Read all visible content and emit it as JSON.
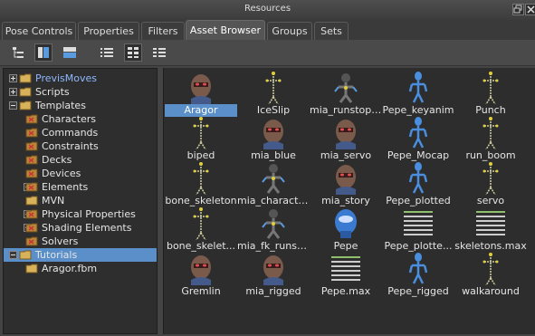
{
  "window": {
    "title": "Resources"
  },
  "tabs": [
    {
      "label": "Pose Controls"
    },
    {
      "label": "Properties"
    },
    {
      "label": "Filters"
    },
    {
      "label": "Asset Browser",
      "active": true
    },
    {
      "label": "Groups"
    },
    {
      "label": "Sets"
    }
  ],
  "toolbar": {
    "buttons": [
      {
        "icon": "tree-hierarchy-icon"
      },
      {
        "icon": "split-vertical-icon",
        "active": true
      },
      {
        "icon": "split-horizontal-icon"
      },
      {
        "icon": "list-view-icon"
      },
      {
        "icon": "thumbnail-view-icon",
        "active": true
      },
      {
        "icon": "details-view-icon"
      }
    ]
  },
  "tree": [
    {
      "label": "PrevisMoves",
      "expander": "plus",
      "icon": "folder-icon",
      "highlight": true
    },
    {
      "label": "Scripts",
      "expander": "plus",
      "icon": "folder-icon"
    },
    {
      "label": "Templates",
      "expander": "minus",
      "icon": "folder-icon"
    },
    {
      "label": "Characters",
      "icon": "template-folder-icon"
    },
    {
      "label": "Commands",
      "icon": "template-folder-icon"
    },
    {
      "label": "Constraints",
      "icon": "template-folder-icon"
    },
    {
      "label": "Decks",
      "icon": "template-folder-icon"
    },
    {
      "label": "Devices",
      "icon": "template-folder-icon"
    },
    {
      "label": "Elements",
      "expander": "plus",
      "icon": "template-folder-icon"
    },
    {
      "label": "MVN",
      "icon": "folder-icon"
    },
    {
      "label": "Physical Properties",
      "expander": "plus",
      "icon": "template-folder-icon"
    },
    {
      "label": "Shading Elements",
      "expander": "plus",
      "icon": "template-folder-icon"
    },
    {
      "label": "Solvers",
      "icon": "template-folder-icon"
    },
    {
      "label": "Tutorials",
      "expander": "minus",
      "icon": "folder-icon",
      "selected": true
    },
    {
      "label": "Aragor.fbm",
      "icon": "folder-icon"
    }
  ],
  "assets": [
    {
      "label": "Aragor",
      "icon": "character-head-icon",
      "selected": true
    },
    {
      "label": "IceSlip",
      "icon": "skeleton-icon"
    },
    {
      "label": "mia_runstopt...",
      "icon": "character-rig-icon"
    },
    {
      "label": "Pepe_keyanim",
      "icon": "robot-figure-icon"
    },
    {
      "label": "Punch",
      "icon": "skeleton-icon"
    },
    {
      "label": "biped",
      "icon": "skeleton-icon"
    },
    {
      "label": "mia_blue",
      "icon": "character-head-icon"
    },
    {
      "label": "mia_servo",
      "icon": "character-head-icon"
    },
    {
      "label": "Pepe_Mocap",
      "icon": "robot-figure-icon"
    },
    {
      "label": "run_boom",
      "icon": "skeleton-icon"
    },
    {
      "label": "bone_skeleton",
      "icon": "skeleton-icon"
    },
    {
      "label": "mia_characte...",
      "icon": "character-rig-icon"
    },
    {
      "label": "mia_story",
      "icon": "character-head-icon"
    },
    {
      "label": "Pepe_plotted",
      "icon": "robot-figure-icon"
    },
    {
      "label": "servo",
      "icon": "skeleton-icon"
    },
    {
      "label": "bone_skelet...",
      "icon": "skeleton-icon"
    },
    {
      "label": "mia_fk_runst...",
      "icon": "character-rig-icon"
    },
    {
      "label": "Pepe",
      "icon": "robot-head-icon"
    },
    {
      "label": "Pepe_plotte...",
      "icon": "data-table-icon"
    },
    {
      "label": "skeletons.max",
      "icon": "data-table-icon"
    },
    {
      "label": "Gremlin",
      "icon": "character-head-icon"
    },
    {
      "label": "mia_rigged",
      "icon": "character-head-icon"
    },
    {
      "label": "Pepe.max",
      "icon": "data-table-icon"
    },
    {
      "label": "Pepe_rigged",
      "icon": "robot-figure-icon"
    },
    {
      "label": "walkaround",
      "icon": "skeleton-icon"
    }
  ],
  "colors": {
    "selection": "#5a8fc9",
    "link": "#8fb8ff",
    "folder": "#d8b25a"
  }
}
